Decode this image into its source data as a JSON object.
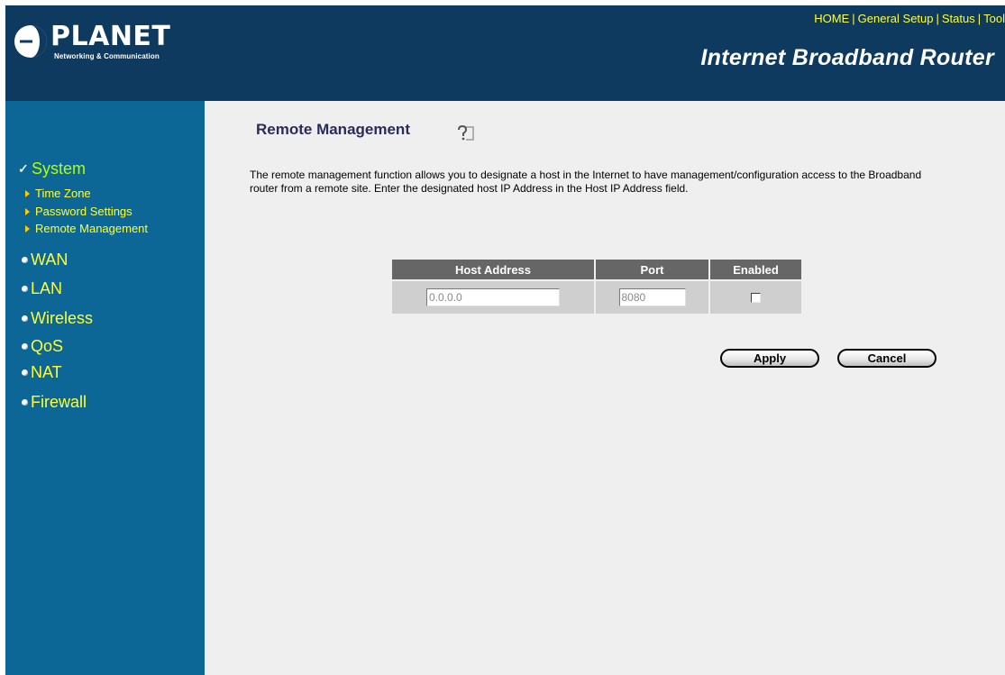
{
  "header": {
    "logo": {
      "word": "PLANET",
      "tagline": "Networking & Communication"
    },
    "nav": {
      "home": "HOME",
      "general_setup": "General Setup",
      "status": "Status",
      "tool": "Tool",
      "separator": "|"
    },
    "product_title": "Internet Broadband Router"
  },
  "sidebar": {
    "system": "System",
    "system_items": [
      "Time Zone",
      "Password Settings",
      "Remote Management"
    ],
    "wan": "WAN",
    "lan": "LAN",
    "wireless": "Wireless",
    "qos": "QoS",
    "nat": "NAT",
    "firewall": "Firewall"
  },
  "main": {
    "title": "Remote Management",
    "description": "The remote management function allows you to designate a host in the Internet to have management/configuration access to the Broadband router from a remote site. Enter the designated host IP Address in the Host IP Address field.",
    "table": {
      "headers": [
        "Host Address",
        "Port",
        "Enabled"
      ],
      "host_address": "0.0.0.0",
      "port": "8080",
      "enabled": false
    },
    "apply_label": "Apply",
    "cancel_label": "Cancel"
  },
  "colors": {
    "header_bg": "#0e3a5f",
    "sidebar_bg": "#0c6797",
    "menu_text": "#ffff33",
    "active_menu_text": "#b6ff00",
    "main_bg": "#efefef",
    "table_header_bg": "#666666",
    "title_text": "#2b2b59"
  }
}
